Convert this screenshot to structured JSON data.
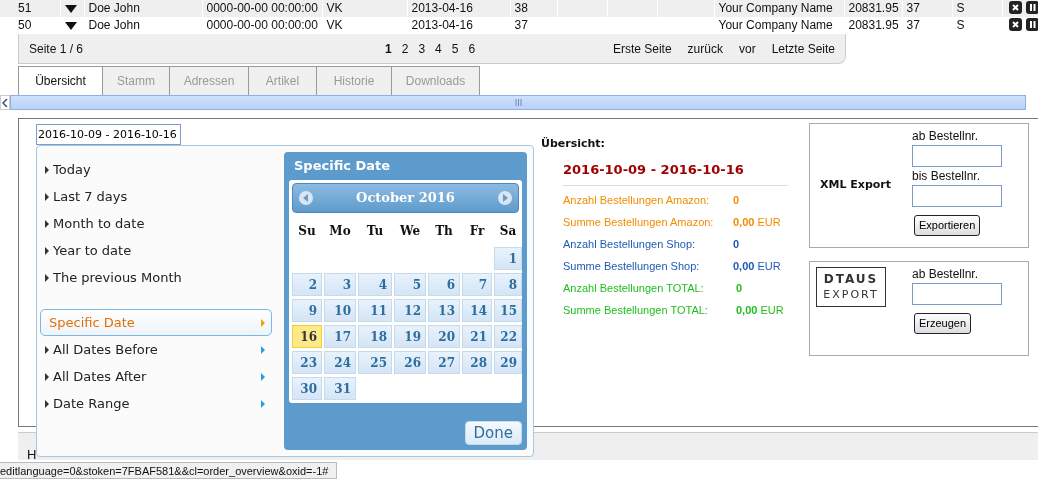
{
  "orders": [
    {
      "number": "51",
      "customer": "Doe John",
      "datetime": "0000-00-00 00:00:00",
      "type": "VK",
      "date": "2013-04-16",
      "column_6": "38",
      "company": "Your Company Name",
      "amount": "20831.95",
      "column_10": "37",
      "column_11": "S"
    },
    {
      "number": "50",
      "customer": "Doe John",
      "datetime": "0000-00-00 00:00:00",
      "type": "VK",
      "date": "2013-04-16",
      "column_6": "37",
      "company": "Your Company Name",
      "amount": "20831.95",
      "column_10": "37",
      "column_11": "S"
    }
  ],
  "pager": {
    "label": "Seite 1 / 6",
    "pages": [
      {
        "label": "1",
        "selected": true
      },
      {
        "label": "2",
        "selected": false
      },
      {
        "label": "3",
        "selected": false
      },
      {
        "label": "4",
        "selected": false
      },
      {
        "label": "5",
        "selected": false
      },
      {
        "label": "6",
        "selected": false
      }
    ],
    "links": [
      "Erste Seite",
      "zurück",
      "vor",
      "Letzte Seite"
    ]
  },
  "tabs": [
    {
      "label": "Übersicht",
      "selected": true
    },
    {
      "label": "Stamm",
      "selected": false
    },
    {
      "label": "Adressen",
      "selected": false
    },
    {
      "label": "Artikel",
      "selected": false
    },
    {
      "label": "Historie",
      "selected": false
    },
    {
      "label": "Downloads",
      "selected": false
    }
  ],
  "date_field": {
    "value": "2016-10-09 - 2016-10-16"
  },
  "overview": {
    "title": "Übersicht:",
    "range": "2016-10-09 - 2016-10-16",
    "stats": [
      {
        "label": "Anzahl Bestellungen Amazon:",
        "value": "0",
        "color": "#f28c00"
      },
      {
        "label": "Summe Bestellungen Amazon:",
        "value": "0,00",
        "unit": "EUR",
        "color": "#f28c00"
      },
      {
        "label": "Anzahl Bestellungen Shop:",
        "value": "0",
        "color": "#1f5bb5"
      },
      {
        "label": "Summe Bestellungen Shop:",
        "value": "0,00",
        "unit": "EUR",
        "color": "#1f5bb5"
      },
      {
        "label": "Anzahl Bestellungen TOTAL:",
        "value": "0",
        "color": "#1fbf1f"
      },
      {
        "label": "Summe Bestellungen TOTAL:",
        "value": "0,00",
        "unit": "EUR",
        "color": "#1fbf1f"
      }
    ]
  },
  "xml_export": {
    "title": "XML Export",
    "fields": [
      {
        "label": "ab Bestellnr."
      },
      {
        "label": "bis Bestellnr."
      }
    ],
    "button": "Exportieren"
  },
  "dtaus_export": {
    "logo_top": "DTAUS",
    "logo_bottom": "EXPORT",
    "fields": [
      {
        "label": "ab Bestellnr."
      }
    ],
    "button": "Erzeugen"
  },
  "bottom_tab": {
    "label": "H"
  },
  "status_url": "editlanguage=0&stoken=7FBAF581&&cl=order_overview&oxid=-1#",
  "date_picker": {
    "presets": [
      {
        "label": "Today",
        "kind": "preset",
        "selected": false
      },
      {
        "label": "Last 7 days",
        "kind": "preset",
        "selected": false
      },
      {
        "label": "Month to date",
        "kind": "preset",
        "selected": false
      },
      {
        "label": "Year to date",
        "kind": "preset",
        "selected": false
      },
      {
        "label": "The previous Month",
        "kind": "preset",
        "selected": false
      },
      {
        "label": "Specific Date",
        "kind": "submenu",
        "selected": true
      },
      {
        "label": "All Dates Before",
        "kind": "submenu",
        "selected": false
      },
      {
        "label": "All Dates After",
        "kind": "submenu",
        "selected": false
      },
      {
        "label": "Date Range",
        "kind": "submenu",
        "selected": false
      }
    ],
    "panel_title": "Specific Date",
    "month": "October 2016",
    "weekdays": [
      "Su",
      "Mo",
      "Tu",
      "We",
      "Th",
      "Fr",
      "Sa"
    ],
    "weeks": [
      [
        {
          "day": "1",
          "selected": false
        }
      ],
      [
        {
          "day": "2",
          "selected": false
        },
        {
          "day": "3",
          "selected": false
        },
        {
          "day": "4",
          "selected": false
        },
        {
          "day": "5",
          "selected": false
        },
        {
          "day": "6",
          "selected": false
        },
        {
          "day": "7",
          "selected": false
        },
        {
          "day": "8",
          "selected": false
        }
      ],
      [
        {
          "day": "9",
          "selected": false
        },
        {
          "day": "10",
          "selected": false
        },
        {
          "day": "11",
          "selected": false
        },
        {
          "day": "12",
          "selected": false
        },
        {
          "day": "13",
          "selected": false
        },
        {
          "day": "14",
          "selected": false
        },
        {
          "day": "15",
          "selected": false
        }
      ],
      [
        {
          "day": "16",
          "selected": true
        },
        {
          "day": "17",
          "selected": false
        },
        {
          "day": "18",
          "selected": false
        },
        {
          "day": "19",
          "selected": false
        },
        {
          "day": "20",
          "selected": false
        },
        {
          "day": "21",
          "selected": false
        },
        {
          "day": "22",
          "selected": false
        }
      ],
      [
        {
          "day": "23",
          "selected": false
        },
        {
          "day": "24",
          "selected": false
        },
        {
          "day": "25",
          "selected": false
        },
        {
          "day": "26",
          "selected": false
        },
        {
          "day": "27",
          "selected": false
        },
        {
          "day": "28",
          "selected": false
        },
        {
          "day": "29",
          "selected": false
        }
      ],
      [
        {
          "day": "30",
          "selected": false
        },
        {
          "day": "31",
          "selected": false
        }
      ]
    ],
    "done_button": "Done"
  }
}
